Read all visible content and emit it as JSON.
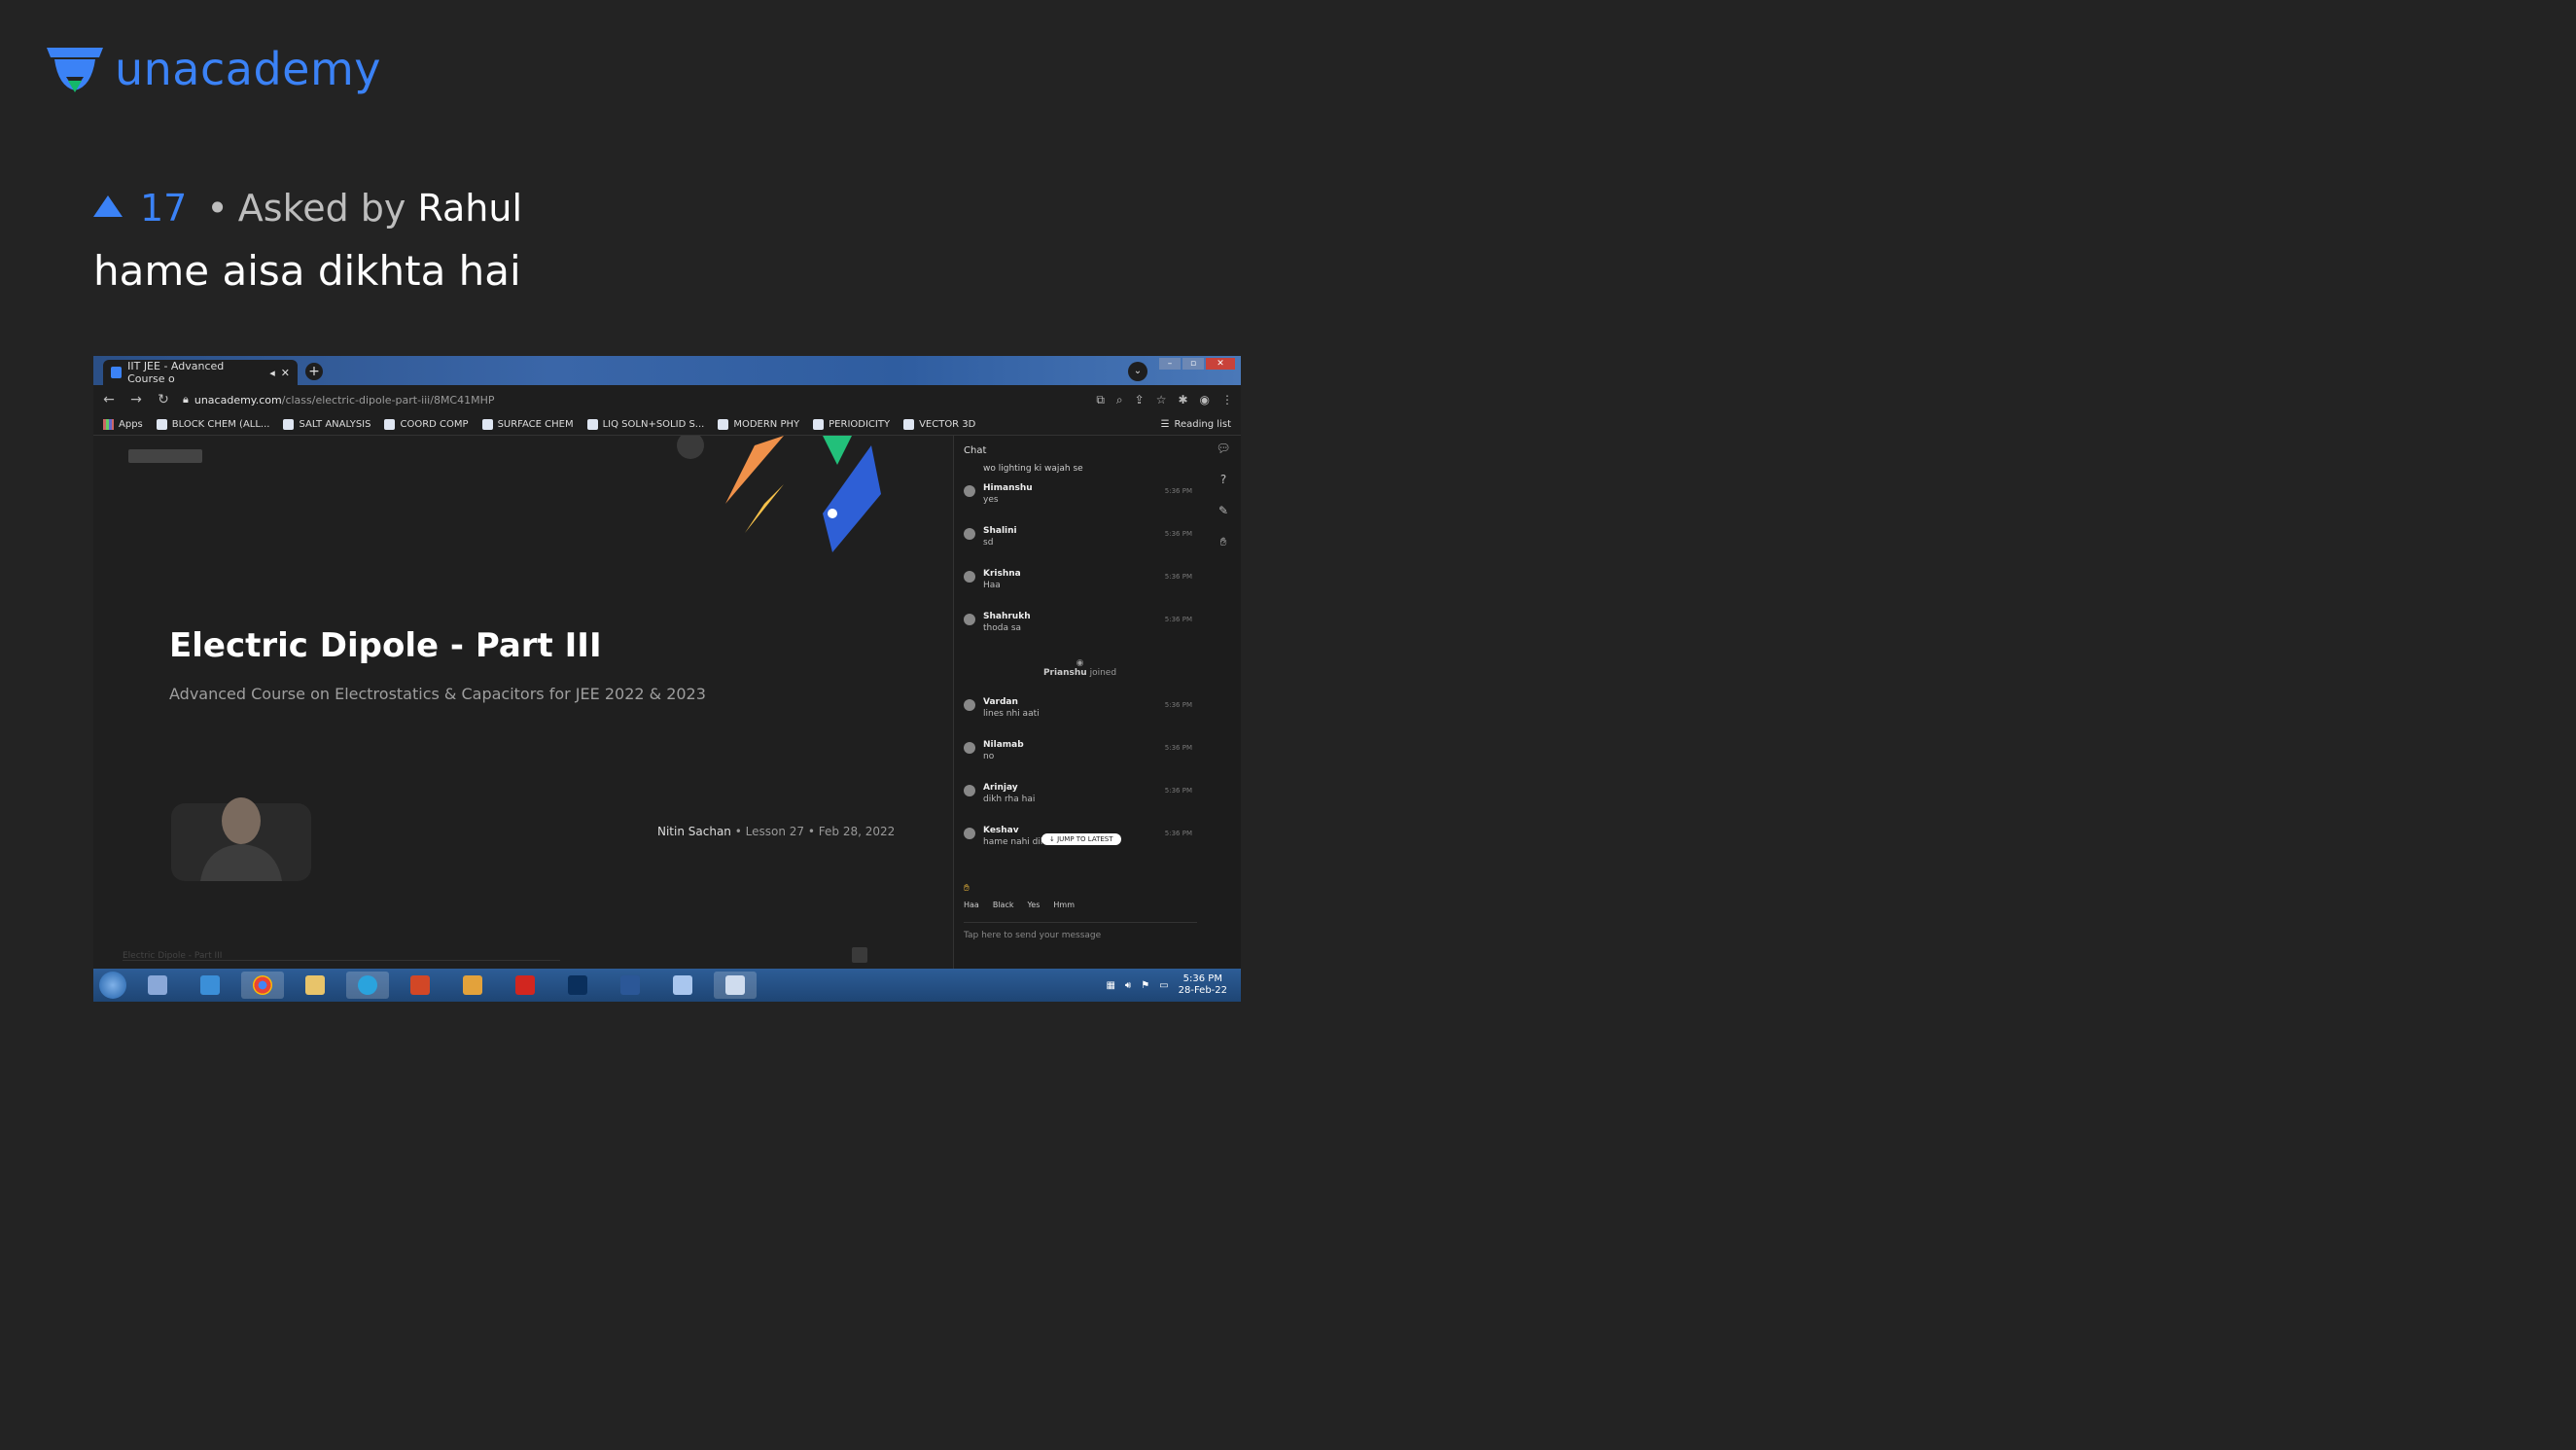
{
  "brand": {
    "name": "unacademy",
    "color": "#3b82f6"
  },
  "question": {
    "upvotes": "17",
    "asked_by_prefix": "Asked by",
    "separator": "•",
    "asker": "Rahul",
    "text": "hame aisa dikhta hai"
  },
  "screenshot": {
    "tab_title": "IIT JEE - Advanced Course o",
    "url_host": "unacademy.com",
    "url_path": "/class/electric-dipole-part-iii/8MC41MHP",
    "bookmarks": [
      "Apps",
      "BLOCK CHEM (ALL...",
      "SALT ANALYSIS",
      "COORD COMP",
      "SURFACE CHEM",
      "LIQ SOLN+SOLID S...",
      "MODERN PHY",
      "PERIODICITY",
      "VECTOR 3D"
    ],
    "reading_list": "Reading list",
    "slide": {
      "title": "Electric Dipole - Part III",
      "subtitle": "Advanced Course on Electrostatics & Capacitors for JEE 2022 & 2023",
      "teacher": "Nitin Sachan",
      "lesson": "Lesson 27",
      "date": "Feb 28, 2022",
      "footer": "Electric Dipole - Part III"
    },
    "chat": {
      "header": "Chat",
      "top_line": "wo lighting ki wajah se",
      "messages": [
        {
          "name": "Himanshu",
          "text": "yes",
          "time": "5:36 PM"
        },
        {
          "name": "Shalini",
          "text": "sd",
          "time": "5:36 PM"
        },
        {
          "name": "Krishna",
          "text": "Haa",
          "time": "5:36 PM"
        },
        {
          "name": "Shahrukh",
          "text": "thoda sa",
          "time": "5:36 PM"
        }
      ],
      "joined_name": "Prianshu",
      "joined_text": "joined",
      "messages2": [
        {
          "name": "Vardan",
          "text": "lines nhi aati",
          "time": "5:36 PM"
        },
        {
          "name": "Nilamab",
          "text": "no",
          "time": "5:36 PM"
        },
        {
          "name": "Arinjay",
          "text": "dikh rha hai",
          "time": "5:36 PM"
        },
        {
          "name": "Keshav",
          "text": "hame nahi dikh",
          "time": "5:36 PM"
        }
      ],
      "jump_label": "↓ JUMP TO LATEST",
      "quick_replies": [
        "Haa",
        "Black",
        "Yes",
        "Hmm"
      ],
      "input_placeholder": "Tap here to send your message"
    },
    "taskbar": {
      "time": "5:36 PM",
      "date": "28-Feb-22"
    }
  }
}
